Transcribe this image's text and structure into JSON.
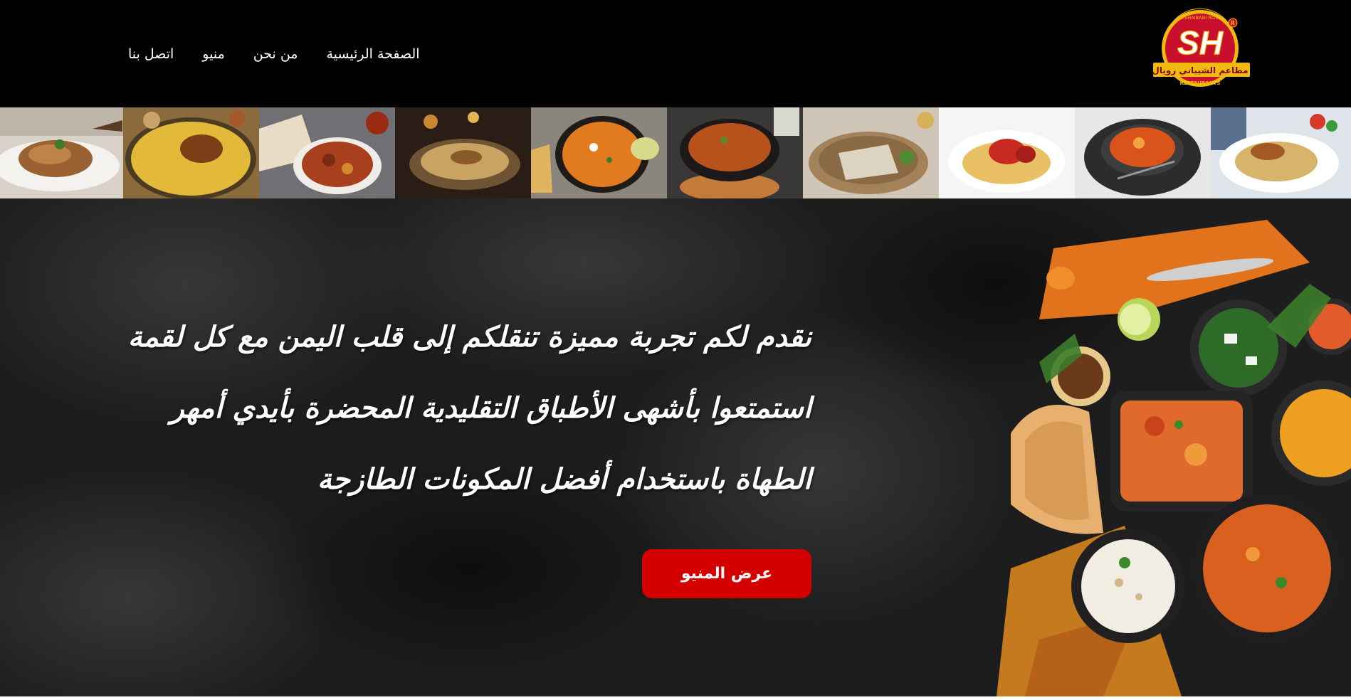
{
  "header": {
    "logo": {
      "icon": "sh-restaurant-logo",
      "monogram": "SH",
      "brand_top": "AL-SHAIBANI ROYAL",
      "brand_ar": "مطاعم الشيباني رويال",
      "brand_bottom": "RESTAURANTS",
      "registered": "R"
    },
    "nav": [
      {
        "label": "الصفحة الرئيسية"
      },
      {
        "label": "من نحن"
      },
      {
        "label": "منيو"
      },
      {
        "label": "اتصل بنا"
      }
    ]
  },
  "food_strip": {
    "tiles": [
      {
        "icon": "lamb-platter-photo"
      },
      {
        "icon": "mandi-rice-photo"
      },
      {
        "icon": "meat-stew-bread-photo"
      },
      {
        "icon": "candlelit-rice-dish-photo"
      },
      {
        "icon": "curry-skillet-photo"
      },
      {
        "icon": "fahsa-clay-pot-photo"
      },
      {
        "icon": "flatbread-plate-photo"
      },
      {
        "icon": "chicken-rice-photo"
      },
      {
        "icon": "stone-pot-soup-photo"
      },
      {
        "icon": "rice-chicken-plate-photo"
      }
    ]
  },
  "hero": {
    "lines": [
      "نقدم لكم تجربة مميزة تنقلكم إلى قلب اليمن مع كل لقمة",
      "استمتعوا بأشهى الأطباق التقليدية المحضرة بأيدي أمهر",
      "الطهاة باستخدام أفضل المكونات الطازجة"
    ],
    "cta_label": "عرض المنيو",
    "food_image": {
      "icon": "spread-of-dishes-photo"
    }
  },
  "colors": {
    "header_bg": "#000000",
    "hero_bg": "#1a1a1a",
    "cta": "#d40000",
    "logo_red": "#c8102e",
    "logo_gold": "#f2b90f"
  }
}
